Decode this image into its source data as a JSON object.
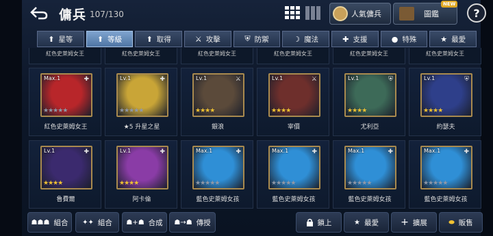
{
  "header": {
    "title": "傭兵",
    "count": "107/130",
    "popular_label": "人氣傭兵",
    "book_label": "圖鑑",
    "new_badge": "NEW",
    "help": "?"
  },
  "tabs": [
    {
      "label": "星等",
      "icon": "arrow-up-icon",
      "active": false
    },
    {
      "label": "等級",
      "icon": "arrow-up-icon",
      "active": true
    },
    {
      "label": "取得",
      "icon": "arrow-up-icon",
      "active": false
    },
    {
      "label": "攻擊",
      "icon": "sword-icon",
      "active": false
    },
    {
      "label": "防禦",
      "icon": "shield-icon",
      "active": false
    },
    {
      "label": "魔法",
      "icon": "magic-hat-icon",
      "active": false
    },
    {
      "label": "支援",
      "icon": "support-icon",
      "active": false
    },
    {
      "label": "特殊",
      "icon": "slime-icon",
      "active": false
    },
    {
      "label": "最愛",
      "icon": "star-icon",
      "active": false
    }
  ],
  "top_row_names": [
    "紅色史萊姆女王",
    "紅色史萊姆女王",
    "紅色史萊姆女王",
    "紅色史萊姆女王",
    "紅色史萊姆女王",
    "紅色史萊姆女王"
  ],
  "row1": [
    {
      "level": "Max.1",
      "name": "紅色史萊姆女王",
      "stars_gold": 0,
      "stars_total": 5,
      "color": "#b8262a",
      "corner": "support-icon"
    },
    {
      "level": "Lv.1",
      "name": "★5 升星之星",
      "stars_gold": 0,
      "stars_total": 5,
      "color": "#c9a537",
      "corner": "support-icon"
    },
    {
      "level": "Lv.1",
      "name": "銀浪",
      "stars_gold": 4,
      "stars_total": 4,
      "color": "#5b4a3a",
      "corner": "sword-icon"
    },
    {
      "level": "Lv.1",
      "name": "宰價",
      "stars_gold": 4,
      "stars_total": 4,
      "color": "#6e2f2c",
      "corner": "sword-icon"
    },
    {
      "level": "Lv.1",
      "name": "尤利亞",
      "stars_gold": 4,
      "stars_total": 4,
      "color": "#3d6a58",
      "corner": "shield-icon"
    },
    {
      "level": "Lv.1",
      "name": "約瑟夫",
      "stars_gold": 4,
      "stars_total": 4,
      "color": "#2e3f8a",
      "corner": "shield-icon"
    }
  ],
  "row2": [
    {
      "level": "Lv.1",
      "name": "魯費爾",
      "stars_gold": 4,
      "stars_total": 4,
      "color": "#3b2a6e",
      "corner": "support-icon"
    },
    {
      "level": "Lv.1",
      "name": "阿卡倫",
      "stars_gold": 4,
      "stars_total": 4,
      "color": "#8a3ca6",
      "corner": "support-icon"
    },
    {
      "level": "Max.1",
      "name": "藍色史萊姆女孩",
      "stars_gold": 0,
      "stars_total": 5,
      "color": "#2f8fd6",
      "corner": "support-icon"
    },
    {
      "level": "Max.1",
      "name": "藍色史萊姆女孩",
      "stars_gold": 0,
      "stars_total": 5,
      "color": "#2f8fd6",
      "corner": "support-icon"
    },
    {
      "level": "Max.1",
      "name": "藍色史萊姆女孩",
      "stars_gold": 0,
      "stars_total": 5,
      "color": "#2f8fd6",
      "corner": "support-icon"
    },
    {
      "level": "Max.1",
      "name": "藍色史萊姆女孩",
      "stars_gold": 0,
      "stars_total": 5,
      "color": "#2f8fd6",
      "corner": "support-icon"
    }
  ],
  "bottom": {
    "combo1": "組合",
    "combo2": "組合",
    "synth": "合成",
    "transfer": "傳授",
    "lock": "鎖上",
    "favorite": "最愛",
    "expand": "擴展",
    "sell": "販售"
  },
  "colors": {
    "accent": "#6e93c2",
    "gold": "#f1c232"
  }
}
